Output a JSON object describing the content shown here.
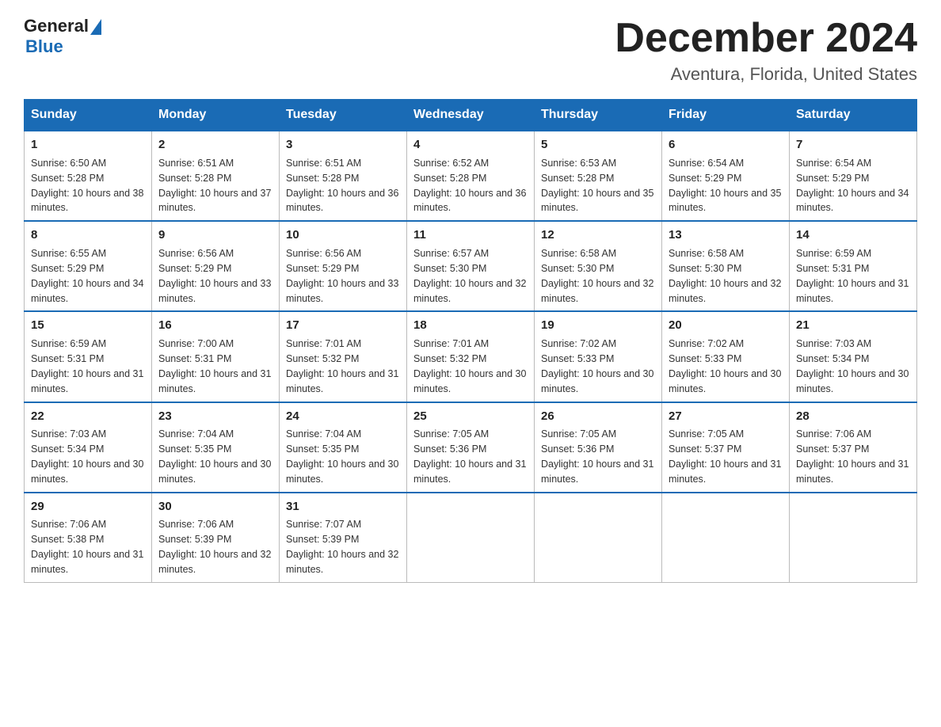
{
  "header": {
    "logo_general": "General",
    "logo_blue": "Blue",
    "month_title": "December 2024",
    "location": "Aventura, Florida, United States"
  },
  "days_of_week": [
    "Sunday",
    "Monday",
    "Tuesday",
    "Wednesday",
    "Thursday",
    "Friday",
    "Saturday"
  ],
  "weeks": [
    [
      {
        "day": "1",
        "sunrise": "6:50 AM",
        "sunset": "5:28 PM",
        "daylight": "10 hours and 38 minutes."
      },
      {
        "day": "2",
        "sunrise": "6:51 AM",
        "sunset": "5:28 PM",
        "daylight": "10 hours and 37 minutes."
      },
      {
        "day": "3",
        "sunrise": "6:51 AM",
        "sunset": "5:28 PM",
        "daylight": "10 hours and 36 minutes."
      },
      {
        "day": "4",
        "sunrise": "6:52 AM",
        "sunset": "5:28 PM",
        "daylight": "10 hours and 36 minutes."
      },
      {
        "day": "5",
        "sunrise": "6:53 AM",
        "sunset": "5:28 PM",
        "daylight": "10 hours and 35 minutes."
      },
      {
        "day": "6",
        "sunrise": "6:54 AM",
        "sunset": "5:29 PM",
        "daylight": "10 hours and 35 minutes."
      },
      {
        "day": "7",
        "sunrise": "6:54 AM",
        "sunset": "5:29 PM",
        "daylight": "10 hours and 34 minutes."
      }
    ],
    [
      {
        "day": "8",
        "sunrise": "6:55 AM",
        "sunset": "5:29 PM",
        "daylight": "10 hours and 34 minutes."
      },
      {
        "day": "9",
        "sunrise": "6:56 AM",
        "sunset": "5:29 PM",
        "daylight": "10 hours and 33 minutes."
      },
      {
        "day": "10",
        "sunrise": "6:56 AM",
        "sunset": "5:29 PM",
        "daylight": "10 hours and 33 minutes."
      },
      {
        "day": "11",
        "sunrise": "6:57 AM",
        "sunset": "5:30 PM",
        "daylight": "10 hours and 32 minutes."
      },
      {
        "day": "12",
        "sunrise": "6:58 AM",
        "sunset": "5:30 PM",
        "daylight": "10 hours and 32 minutes."
      },
      {
        "day": "13",
        "sunrise": "6:58 AM",
        "sunset": "5:30 PM",
        "daylight": "10 hours and 32 minutes."
      },
      {
        "day": "14",
        "sunrise": "6:59 AM",
        "sunset": "5:31 PM",
        "daylight": "10 hours and 31 minutes."
      }
    ],
    [
      {
        "day": "15",
        "sunrise": "6:59 AM",
        "sunset": "5:31 PM",
        "daylight": "10 hours and 31 minutes."
      },
      {
        "day": "16",
        "sunrise": "7:00 AM",
        "sunset": "5:31 PM",
        "daylight": "10 hours and 31 minutes."
      },
      {
        "day": "17",
        "sunrise": "7:01 AM",
        "sunset": "5:32 PM",
        "daylight": "10 hours and 31 minutes."
      },
      {
        "day": "18",
        "sunrise": "7:01 AM",
        "sunset": "5:32 PM",
        "daylight": "10 hours and 30 minutes."
      },
      {
        "day": "19",
        "sunrise": "7:02 AM",
        "sunset": "5:33 PM",
        "daylight": "10 hours and 30 minutes."
      },
      {
        "day": "20",
        "sunrise": "7:02 AM",
        "sunset": "5:33 PM",
        "daylight": "10 hours and 30 minutes."
      },
      {
        "day": "21",
        "sunrise": "7:03 AM",
        "sunset": "5:34 PM",
        "daylight": "10 hours and 30 minutes."
      }
    ],
    [
      {
        "day": "22",
        "sunrise": "7:03 AM",
        "sunset": "5:34 PM",
        "daylight": "10 hours and 30 minutes."
      },
      {
        "day": "23",
        "sunrise": "7:04 AM",
        "sunset": "5:35 PM",
        "daylight": "10 hours and 30 minutes."
      },
      {
        "day": "24",
        "sunrise": "7:04 AM",
        "sunset": "5:35 PM",
        "daylight": "10 hours and 30 minutes."
      },
      {
        "day": "25",
        "sunrise": "7:05 AM",
        "sunset": "5:36 PM",
        "daylight": "10 hours and 31 minutes."
      },
      {
        "day": "26",
        "sunrise": "7:05 AM",
        "sunset": "5:36 PM",
        "daylight": "10 hours and 31 minutes."
      },
      {
        "day": "27",
        "sunrise": "7:05 AM",
        "sunset": "5:37 PM",
        "daylight": "10 hours and 31 minutes."
      },
      {
        "day": "28",
        "sunrise": "7:06 AM",
        "sunset": "5:37 PM",
        "daylight": "10 hours and 31 minutes."
      }
    ],
    [
      {
        "day": "29",
        "sunrise": "7:06 AM",
        "sunset": "5:38 PM",
        "daylight": "10 hours and 31 minutes."
      },
      {
        "day": "30",
        "sunrise": "7:06 AM",
        "sunset": "5:39 PM",
        "daylight": "10 hours and 32 minutes."
      },
      {
        "day": "31",
        "sunrise": "7:07 AM",
        "sunset": "5:39 PM",
        "daylight": "10 hours and 32 minutes."
      },
      null,
      null,
      null,
      null
    ]
  ]
}
